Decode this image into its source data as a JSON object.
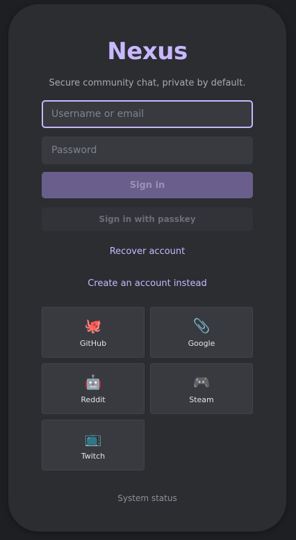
{
  "app": {
    "title": "Nexus",
    "tagline": "Secure community chat, private by default."
  },
  "form": {
    "username_placeholder": "Username or email",
    "username_value": "",
    "password_placeholder": "Password",
    "password_value": "",
    "sign_in_label": "Sign in",
    "passkey_label": "Sign in with passkey"
  },
  "links": {
    "recover": "Recover account",
    "create": "Create an account instead",
    "status": "System status"
  },
  "providers": [
    {
      "label": "GitHub",
      "icon": "🐙",
      "icon_name": "octopus-icon"
    },
    {
      "label": "Google",
      "icon": "📎",
      "icon_name": "paperclip-icon"
    },
    {
      "label": "Reddit",
      "icon": "🤖",
      "icon_name": "robot-icon"
    },
    {
      "label": "Steam",
      "icon": "🎮",
      "icon_name": "gamepad-icon"
    },
    {
      "label": "Twitch",
      "icon": "📺",
      "icon_name": "television-icon"
    }
  ],
  "colors": {
    "accent": "#c9b8ff",
    "card_bg": "#2b2d31",
    "input_bg": "#383a40",
    "primary_button": "#6a5f8c"
  }
}
